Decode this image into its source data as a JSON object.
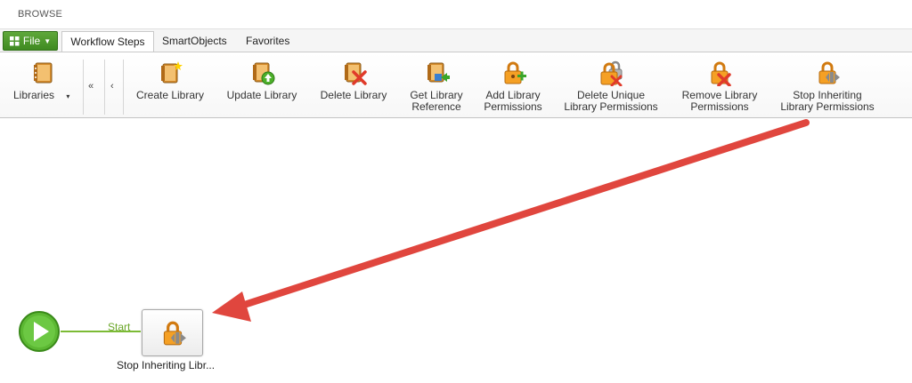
{
  "topbar": {
    "browse_label": "BROWSE"
  },
  "tabs": {
    "file_label": "File",
    "items": [
      {
        "label": "Workflow Steps"
      },
      {
        "label": "SmartObjects"
      },
      {
        "label": "Favorites"
      }
    ]
  },
  "ribbon": {
    "libraries_label": "Libraries",
    "buttons": [
      {
        "label": "Create Library",
        "icon": "create-library-icon"
      },
      {
        "label": "Update Library",
        "icon": "update-library-icon"
      },
      {
        "label": "Delete Library",
        "icon": "delete-library-icon"
      },
      {
        "label_line1": "Get Library",
        "label_line2": "Reference",
        "icon": "get-library-reference-icon"
      },
      {
        "label_line1": "Add Library",
        "label_line2": "Permissions",
        "icon": "add-permissions-icon"
      },
      {
        "label_line1": "Delete Unique",
        "label_line2": "Library Permissions",
        "icon": "delete-unique-permissions-icon"
      },
      {
        "label_line1": "Remove Library",
        "label_line2": "Permissions",
        "icon": "remove-permissions-icon"
      },
      {
        "label_line1": "Stop Inheriting",
        "label_line2": "Library Permissions",
        "icon": "stop-inheriting-icon"
      }
    ]
  },
  "canvas": {
    "start_label": "Start",
    "step_label": "Stop Inheriting Libr..."
  },
  "colors": {
    "file_green": "#4a9a2a",
    "start_green": "#5cb833",
    "lock_orange": "#f08a1c",
    "arrow_red": "#e0463e"
  }
}
